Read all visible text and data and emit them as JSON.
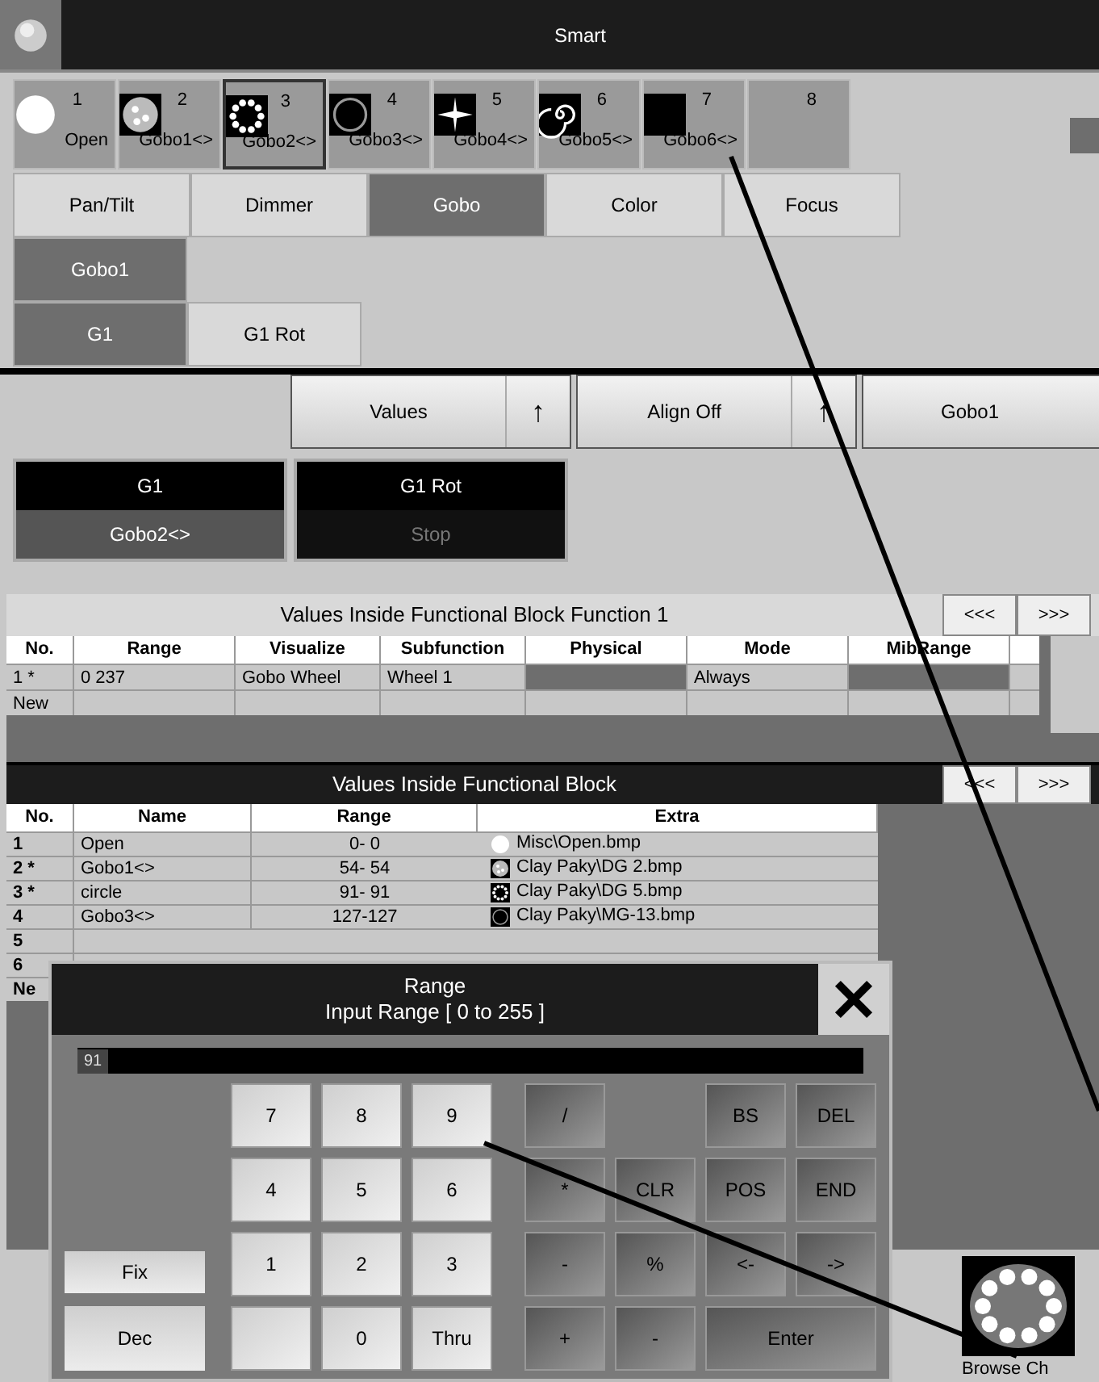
{
  "window": {
    "title": "Smart"
  },
  "gobos": [
    {
      "number": "1",
      "label": "Open",
      "kind": "open",
      "selected": false
    },
    {
      "number": "2",
      "label": "Gobo1<>",
      "kind": "dots",
      "selected": false
    },
    {
      "number": "3",
      "label": "Gobo2<>",
      "kind": "ring",
      "selected": true
    },
    {
      "number": "4",
      "label": "Gobo3<>",
      "kind": "circle",
      "selected": false
    },
    {
      "number": "5",
      "label": "Gobo4<>",
      "kind": "star",
      "selected": false
    },
    {
      "number": "6",
      "label": "Gobo5<>",
      "kind": "spiral",
      "selected": false
    },
    {
      "number": "7",
      "label": "Gobo6<>",
      "kind": "solid",
      "selected": false
    },
    {
      "number": "8",
      "kind": "none",
      "selected": false
    }
  ],
  "feature_tabs": [
    {
      "label": "Pan/Tilt",
      "selected": false
    },
    {
      "label": "Dimmer",
      "selected": false
    },
    {
      "label": "Gobo",
      "selected": true
    },
    {
      "label": "Color",
      "selected": false
    },
    {
      "label": "Focus",
      "selected": false
    }
  ],
  "attribute_tabs": [
    {
      "label": "Gobo1",
      "selected": true
    }
  ],
  "function_tabs": [
    {
      "label": "G1",
      "selected": true
    },
    {
      "label": "G1 Rot",
      "selected": false
    }
  ],
  "toolbar": [
    {
      "label": "Values",
      "arrow": "↑"
    },
    {
      "label": "Align Off",
      "arrow": "↑"
    },
    {
      "label": "Gobo1"
    }
  ],
  "channels": [
    {
      "name": "G1",
      "value": "Gobo2<>",
      "active": true
    },
    {
      "name": "G1 Rot",
      "value": "Stop",
      "active": false
    }
  ],
  "function_table": {
    "title": "Values Inside Functional Block Function 1",
    "prev": "<<<",
    "next": ">>>",
    "columns": [
      "No.",
      "Range",
      "Visualize",
      "Subfunction",
      "Physical",
      "Mode",
      "MibRange"
    ],
    "rows": [
      [
        "1 *",
        "0 237",
        "Gobo Wheel",
        "Wheel 1",
        "",
        "Always",
        ""
      ],
      [
        "New",
        "",
        "",
        "",
        "",
        "",
        ""
      ]
    ]
  },
  "value_table": {
    "title": "Values Inside Functional Block",
    "prev": "<<<",
    "next": ">>>",
    "columns": [
      "No.",
      "Name",
      "Range",
      "Extra"
    ],
    "rows": [
      {
        "no": "1",
        "name": "Open",
        "range": "0- 0",
        "extra": "Misc\\Open.bmp",
        "kind": "open"
      },
      {
        "no": "2 *",
        "name": "Gobo1<>",
        "range": "54- 54",
        "extra": "Clay Paky\\DG 2.bmp",
        "kind": "dots"
      },
      {
        "no": "3 *",
        "name": "circle",
        "range": "91- 91",
        "extra": "Clay Paky\\DG 5.bmp",
        "kind": "ring"
      },
      {
        "no": "4",
        "name": "Gobo3<>",
        "range": "127-127",
        "extra": "Clay Paky\\MG-13.bmp",
        "kind": "circle"
      },
      {
        "no": "5"
      },
      {
        "no": "6"
      },
      {
        "no": "Ne"
      }
    ]
  },
  "dialog": {
    "title": "Range",
    "subtitle": "Input Range [ 0 to 255 ]",
    "value": "91",
    "side_buttons": [
      "Fix",
      "Dec"
    ],
    "keys": [
      [
        {
          "kind": "light",
          "label": "7"
        },
        {
          "kind": "light",
          "label": "8"
        },
        {
          "kind": "light",
          "label": "9"
        },
        {
          "kind": "dark",
          "label": "/"
        },
        {
          "kind": "gap"
        },
        {
          "kind": "dark",
          "label": "BS"
        },
        {
          "kind": "dark",
          "label": "DEL"
        }
      ],
      [
        {
          "kind": "light",
          "label": "4"
        },
        {
          "kind": "light",
          "label": "5"
        },
        {
          "kind": "light",
          "label": "6"
        },
        {
          "kind": "dark",
          "label": "*"
        },
        {
          "kind": "dark",
          "label": "CLR"
        },
        {
          "kind": "dark",
          "label": "POS"
        },
        {
          "kind": "dark",
          "label": "END"
        }
      ],
      [
        {
          "kind": "light",
          "label": "1"
        },
        {
          "kind": "light",
          "label": "2"
        },
        {
          "kind": "light",
          "label": "3"
        },
        {
          "kind": "dark",
          "label": "-"
        },
        {
          "kind": "dark",
          "label": "%"
        },
        {
          "kind": "dark",
          "label": "<-"
        },
        {
          "kind": "dark",
          "label": "->"
        }
      ],
      [
        {
          "kind": "light"
        },
        {
          "kind": "light",
          "label": "0"
        },
        {
          "kind": "light",
          "label": "Thru"
        },
        {
          "kind": "dark",
          "label": "+"
        },
        {
          "kind": "dark",
          "label": "-"
        },
        {
          "kind": "wide",
          "label": "Enter"
        }
      ]
    ]
  },
  "preview": {
    "label": "Browse Ch"
  }
}
